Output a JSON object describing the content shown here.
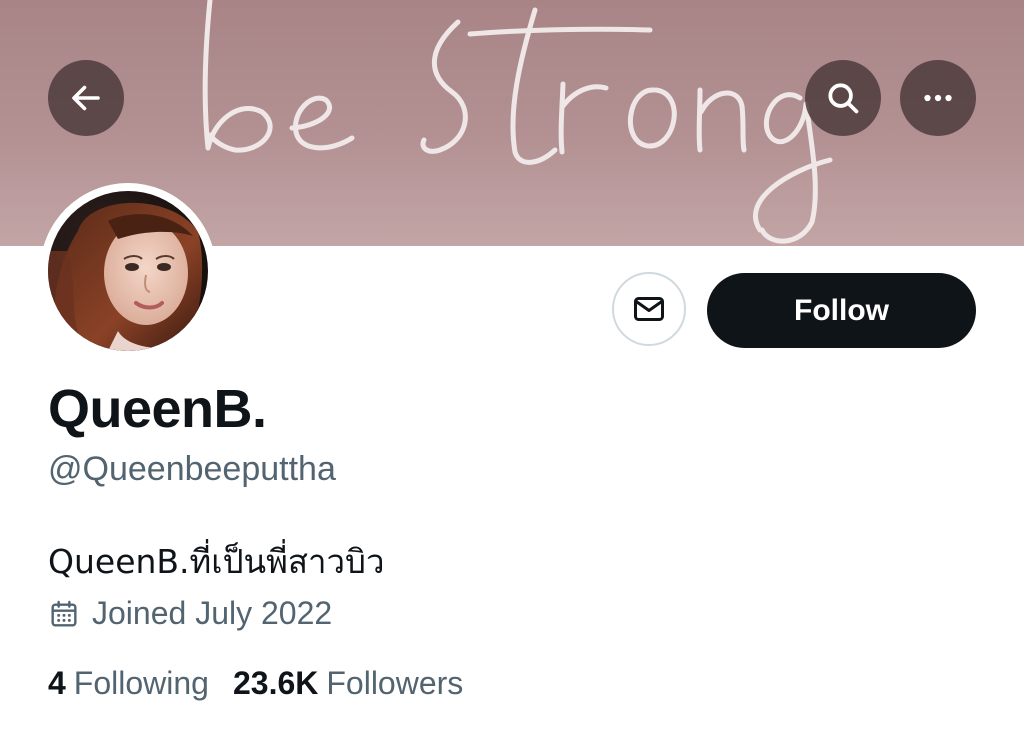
{
  "header": {
    "banner_text": "be strong",
    "back_icon": "arrow-left-icon",
    "search_icon": "search-icon",
    "more_icon": "more-horizontal-icon"
  },
  "profile": {
    "display_name": "QueenB.",
    "handle": "@Queenbeeputtha",
    "bio": "QueenB.ที่เป็นพี่สาวบิว",
    "joined": "Joined July 2022",
    "following_count": "4",
    "following_label": "Following",
    "followers_count": "23.6K",
    "followers_label": "Followers"
  },
  "actions": {
    "message_icon": "mail-icon",
    "follow_label": "Follow"
  },
  "colors": {
    "banner": "#b39193",
    "primary_text": "#0f1419",
    "secondary_text": "#536471",
    "follow_button": "#0f1419",
    "circle_button": "#503e3f"
  }
}
